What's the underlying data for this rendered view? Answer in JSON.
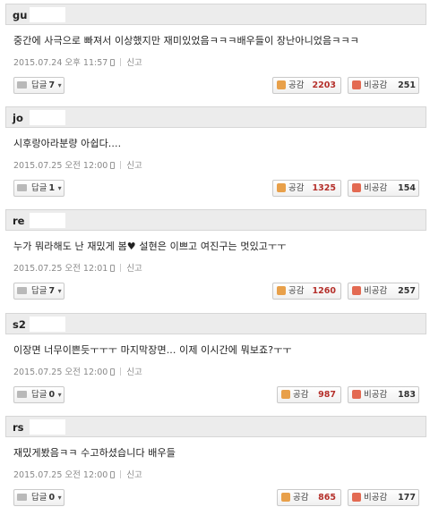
{
  "comments": [
    {
      "user": "gu",
      "text": "중간에 사극으로 빠져서 이상했지만 재미있었음ㅋㅋㅋ배우들이 장난아니었음ㅋㅋㅋ",
      "date": "2015.07.24 오후 11:57",
      "report": "신고",
      "reply_label": "답글",
      "reply_count": "7",
      "like_label": "공감",
      "likes": "2203",
      "dislike_label": "비공감",
      "dislikes": "251"
    },
    {
      "user": "jo",
      "text": "시후랑아라분량 아쉽다....",
      "date": "2015.07.25 오전 12:00",
      "report": "신고",
      "reply_label": "답글",
      "reply_count": "1",
      "like_label": "공감",
      "likes": "1325",
      "dislike_label": "비공감",
      "dislikes": "154"
    },
    {
      "user": "re",
      "text": "누가 뭐라해도 난 재밌게 봄♥ 설현은 이쁘고 여진구는 멋있고ㅜㅜ",
      "date": "2015.07.25 오전 12:01",
      "report": "신고",
      "reply_label": "답글",
      "reply_count": "7",
      "like_label": "공감",
      "likes": "1260",
      "dislike_label": "비공감",
      "dislikes": "257"
    },
    {
      "user": "s2",
      "text": "이장면 너무이쁜듯ㅜㅜㅜ 마지막장면... 이제 이시간에 뭐보죠?ㅜㅜ",
      "date": "2015.07.25 오전 12:00",
      "report": "신고",
      "reply_label": "답글",
      "reply_count": "0",
      "like_label": "공감",
      "likes": "987",
      "dislike_label": "비공감",
      "dislikes": "183"
    },
    {
      "user": "rs",
      "text": "재밌게봤음ㅋㅋ 수고하셨습니다 배우들",
      "date": "2015.07.25 오전 12:00",
      "report": "신고",
      "reply_label": "답글",
      "reply_count": "0",
      "like_label": "공감",
      "likes": "865",
      "dislike_label": "비공감",
      "dislikes": "177"
    }
  ]
}
